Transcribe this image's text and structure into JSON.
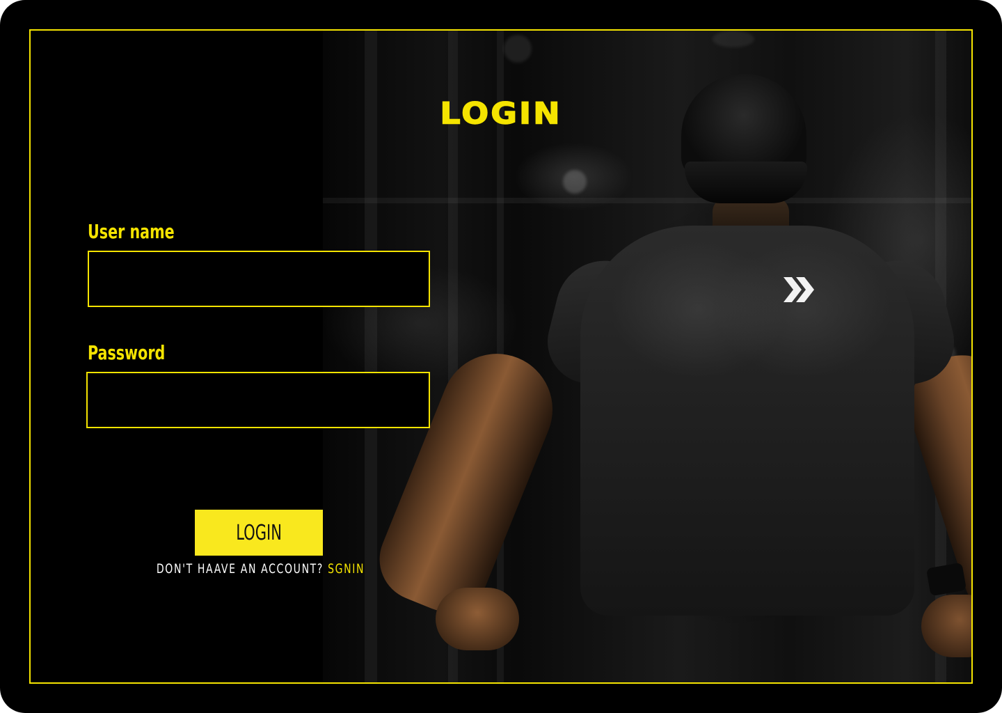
{
  "page": {
    "title": "LOGIN"
  },
  "form": {
    "username_label": "User name",
    "username_value": "",
    "username_placeholder": "",
    "password_label": "Password",
    "password_value": "",
    "password_placeholder": "",
    "submit_label": "LOGIN"
  },
  "signup": {
    "prompt": "DON'T HAAVE AN ACCOUNT?",
    "link_label": "SGNIN"
  },
  "background": {
    "image_subject": "athlete-photo",
    "shirt_logo_icon": "double-chevron-icon"
  },
  "colors": {
    "accent": "#f5e400",
    "button": "#f9e81e",
    "background": "#000000",
    "prompt_text": "#ffffff"
  }
}
